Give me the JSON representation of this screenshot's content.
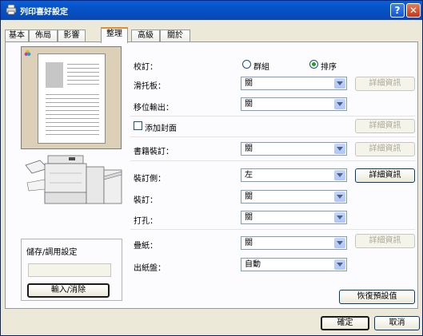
{
  "window": {
    "title": "列印喜好設定",
    "help_label": "?",
    "close_label": "✕",
    "app_icon": "printer-icon"
  },
  "tabs": [
    {
      "label": "基本",
      "active": false
    },
    {
      "label": "佈局",
      "active": false
    },
    {
      "label": "影響",
      "active": false
    },
    {
      "label": "整理",
      "active": true
    },
    {
      "label": "高級",
      "active": false
    },
    {
      "label": "關於",
      "active": false
    }
  ],
  "preview": {
    "icon": "color-icon"
  },
  "saved_settings": {
    "label": "儲存/調用設定",
    "value": "",
    "button": "輸入/消除"
  },
  "settings": {
    "collate": {
      "label": "校訂：",
      "options": [
        "群組",
        "排序"
      ],
      "selected": "排序"
    },
    "offset_stacking": {
      "label": "滑托板：",
      "value": "關",
      "details": "詳細資訊"
    },
    "offset_output": {
      "label": "移位輸出：",
      "value": "關"
    },
    "add_cover": {
      "label": "添加封面",
      "checked": false,
      "details": "詳細資訊"
    },
    "booklet_binding": {
      "label": "書籍裝訂：",
      "value": "關",
      "details": "詳細資訊"
    },
    "binding_side": {
      "label": "裝訂側：",
      "value": "左",
      "details": "詳細資訊"
    },
    "staple": {
      "label": "裝訂：",
      "value": "關"
    },
    "punch": {
      "label": "打孔：",
      "value": "關"
    },
    "fold": {
      "label": "疊紙：",
      "value": "關",
      "details": "詳細資訊"
    },
    "output_tray": {
      "label": "出紙盤：",
      "value": "自動"
    }
  },
  "buttons": {
    "restore_defaults": "恢復預設值",
    "ok": "確定",
    "cancel": "取消"
  }
}
